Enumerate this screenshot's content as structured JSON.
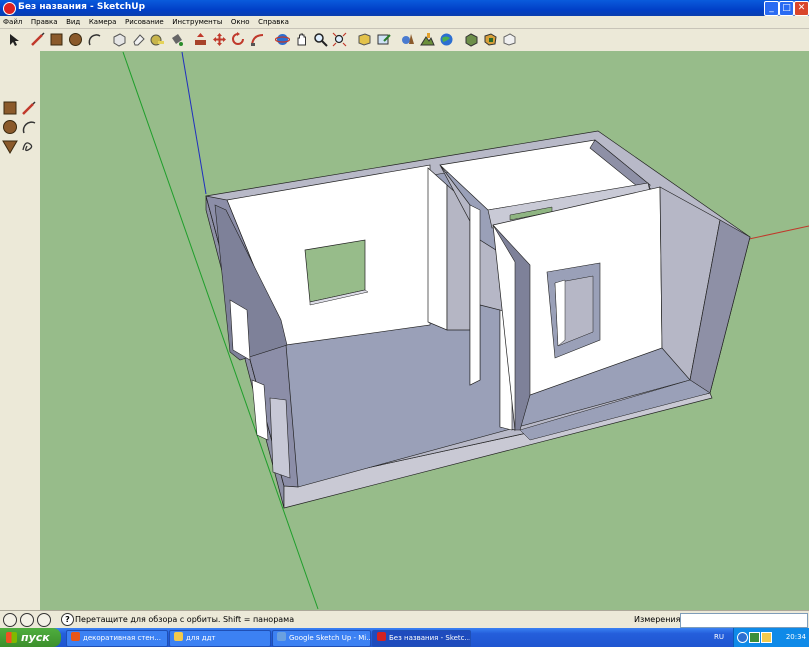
{
  "window": {
    "title": "Без названия - SketchUp",
    "minimize": "_",
    "maximize": "□",
    "close": "✕"
  },
  "menu": [
    "Файл",
    "Правка",
    "Вид",
    "Камера",
    "Рисование",
    "Инструменты",
    "Окно",
    "Справка"
  ],
  "toolbar": {
    "icons": [
      "select-icon",
      "line-icon",
      "rectangle-icon",
      "circle-icon",
      "arc-icon",
      "make-component-icon",
      "eraser-icon",
      "tape-measure-icon",
      "paint-bucket-icon",
      "push-pull-icon",
      "move-icon",
      "rotate-icon",
      "follow-me-icon",
      "orbit-icon",
      "pan-icon",
      "zoom-icon",
      "zoom-extents-icon",
      "get-models-icon",
      "share-model-icon",
      "add-location-icon",
      "toggle-terrain-icon",
      "google-earth-icon",
      "get-photo-texture-icon",
      "photo-textures-icon",
      "warehouse-icon",
      "extension-icon"
    ]
  },
  "sidebar_tools": [
    "rectangle-icon",
    "pencil-icon",
    "circle-icon",
    "arc-icon",
    "polygon-icon",
    "freehand-icon"
  ],
  "status": {
    "hint": "Перетащите для обзора с орбиты.  Shift = панорама",
    "measure_label": "Измерения",
    "measure_value": ""
  },
  "taskbar": {
    "start_label": "пуск",
    "tasks": [
      {
        "label": "декоративная стен...",
        "icon_color": "#e8561a"
      },
      {
        "label": "для ддт",
        "icon_color": "#f2c94c"
      },
      {
        "label": "Google Sketch Up - Mi...",
        "icon_color": "#6aa0e0"
      },
      {
        "label": "Без названия - Sketc...",
        "icon_color": "#d22222"
      }
    ],
    "lang": "RU",
    "clock": "20:34"
  },
  "colors": {
    "sky": "#97bc8a",
    "axis_red": "#c0392b",
    "axis_green": "#1f9e2b",
    "axis_blue": "#1f2fbf",
    "wall_face": "#ffffff",
    "wall_side": "#adadb8",
    "wall_back": "#7a7d96",
    "floor": "#9aa0b8"
  }
}
